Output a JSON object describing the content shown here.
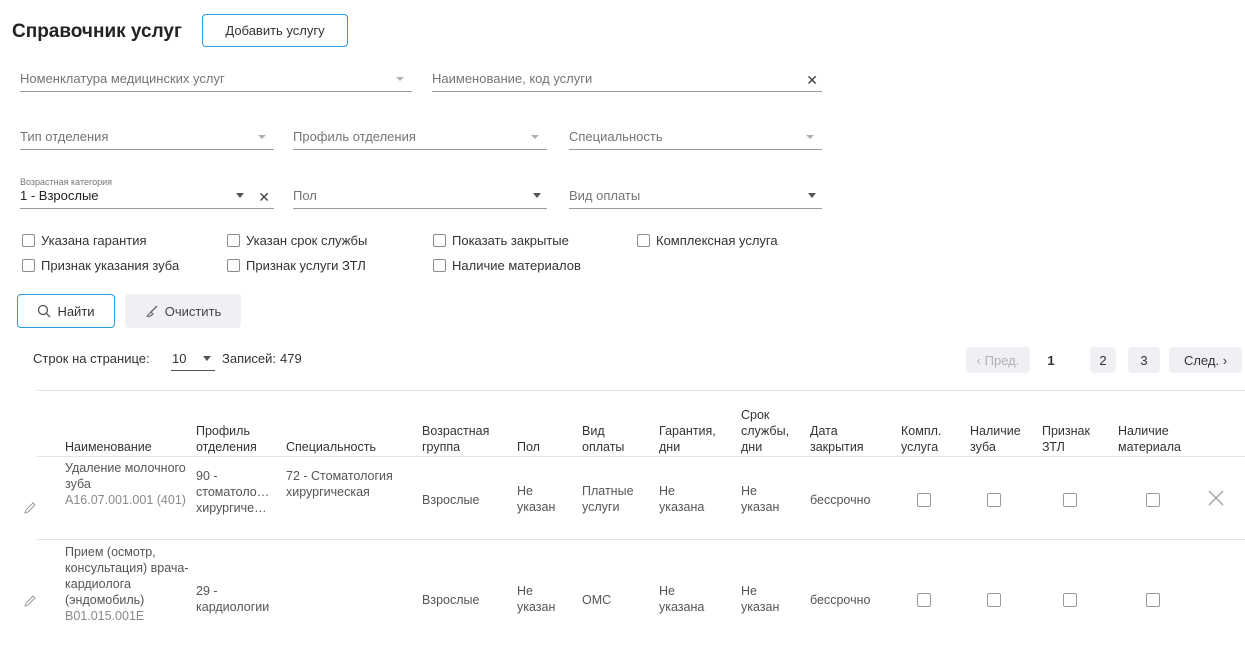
{
  "header": {
    "title": "Справочник услуг",
    "add_button": "Добавить услугу"
  },
  "filters": {
    "nomenclature": {
      "placeholder": "Номенклатура медицинских услуг"
    },
    "name_code": {
      "placeholder": "Наименование, код услуги"
    },
    "dept_type": {
      "placeholder": "Тип отделения"
    },
    "dept_profile": {
      "placeholder": "Профиль отделения"
    },
    "specialty": {
      "placeholder": "Специальность"
    },
    "age_category": {
      "label": "Возрастная категория",
      "value": "1 - Взрослые"
    },
    "sex": {
      "placeholder": "Пол"
    },
    "payment_type": {
      "placeholder": "Вид оплаты"
    }
  },
  "checkboxes": {
    "warranty": "Указана гарантия",
    "service_life": "Указан срок службы",
    "show_closed": "Показать закрытые",
    "complex_service": "Комплексная услуга",
    "tooth_sign": "Признак указания зуба",
    "ztl_sign": "Признак услуги ЗТЛ",
    "materials": "Наличие материалов"
  },
  "actions": {
    "search": "Найти",
    "clear": "Очистить"
  },
  "pagination": {
    "rows_label": "Строк на странице:",
    "rows_value": "10",
    "records_label": "Записей:",
    "records_count": "479",
    "prev": "Пред.",
    "pages": [
      "1",
      "2",
      "3"
    ],
    "next": "След."
  },
  "table": {
    "columns": [
      "Наименование",
      "Профиль отделения",
      "Специальность",
      "Возрастная группа",
      "Пол",
      "Вид оплаты",
      "Гарантия, дни",
      "Срок службы, дни",
      "Дата закрытия",
      "Компл. услуга",
      "Наличие зуба",
      "Признак ЗТЛ",
      "Наличие материала"
    ],
    "rows": [
      {
        "name": "Удаление молочного зуба",
        "code": "A16.07.001.001 (401)",
        "profile": "90 - стоматоло… хирургиче…",
        "specialty": "72 - Стоматология хирургическая",
        "age_group": "Взрослые",
        "sex": "Не указан",
        "payment": "Платные услуги",
        "warranty": "Не указана",
        "service_life": "Не указан",
        "close_date": "бессрочно"
      },
      {
        "name": "Прием (осмотр, консультация) врача-кардиолога (эндомобиль)",
        "code": "B01.015.001E",
        "profile": "29 - кардиологии",
        "specialty": "",
        "age_group": "Взрослые",
        "sex": "Не указан",
        "payment": "ОМС",
        "warranty": "Не указана",
        "service_life": "Не указан",
        "close_date": "бессрочно"
      }
    ]
  },
  "colors": {
    "accent": "#2b9ad6",
    "button_gray": "#eef0f3",
    "border": "#9a9a9a"
  }
}
